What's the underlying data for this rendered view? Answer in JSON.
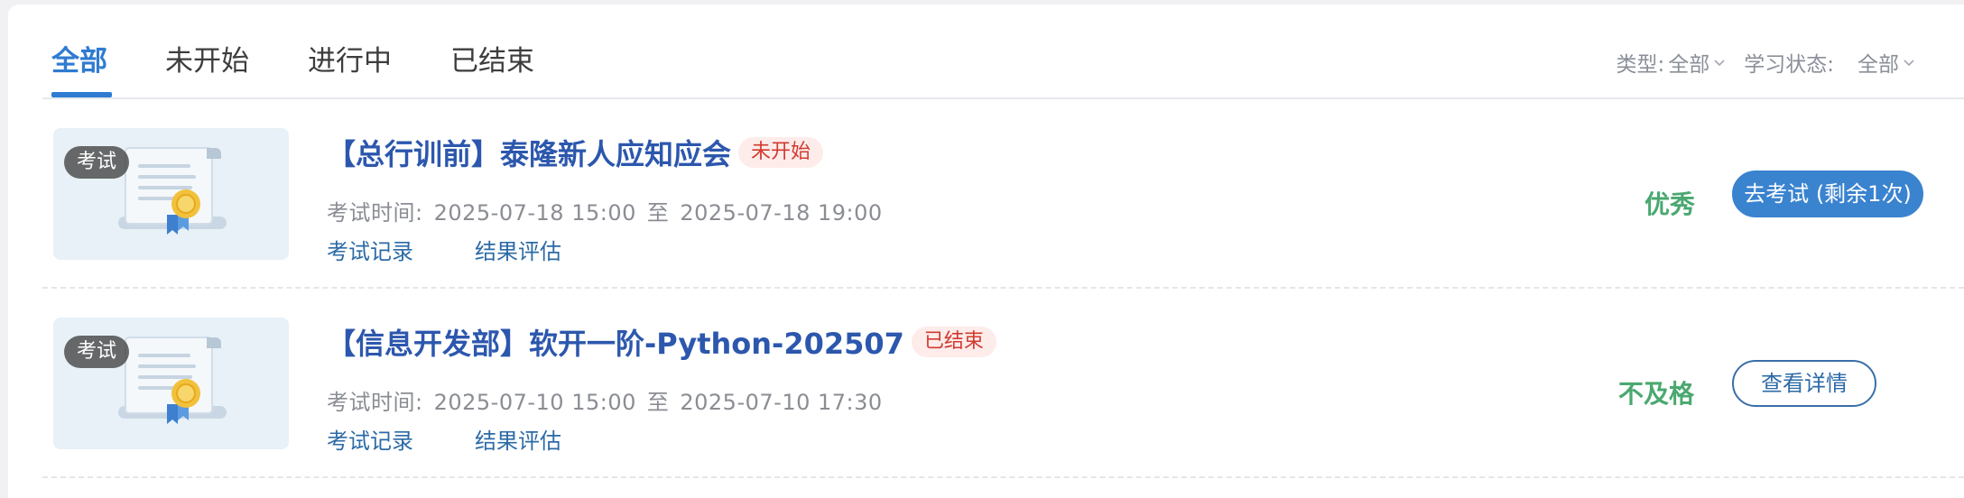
{
  "tabs": [
    {
      "label": "全部",
      "active": true
    },
    {
      "label": "未开始",
      "active": false
    },
    {
      "label": "进行中",
      "active": false
    },
    {
      "label": "已结束",
      "active": false
    }
  ],
  "filters": {
    "type": {
      "label": "类型:",
      "value": "全部"
    },
    "status": {
      "label": "学习状态:",
      "value": "全部"
    }
  },
  "colors": {
    "accent": "#2f7bd1",
    "title": "#2c57ad",
    "grade_green": "#4aa870",
    "tag_red": "#d23a30"
  },
  "items": [
    {
      "thumb_badge": "考试",
      "thumb_icon": "certificate-icon",
      "title": "【总行训前】泰隆新人应知应会",
      "status": "未开始",
      "time_label": "考试时间:",
      "time_start": "2025-07-18 15:00",
      "time_sep": "至",
      "time_end": "2025-07-18 19:00",
      "link_records": "考试记录",
      "link_evaluation": "结果评估",
      "grade": "优秀",
      "action": "去考试 (剩余1次)"
    },
    {
      "thumb_badge": "考试",
      "thumb_icon": "certificate-icon",
      "title": "【信息开发部】软开一阶-Python-202507",
      "status": "已结束",
      "time_label": "考试时间:",
      "time_start": "2025-07-10 15:00",
      "time_sep": "至",
      "time_end": "2025-07-10 17:30",
      "link_records": "考试记录",
      "link_evaluation": "结果评估",
      "grade": "不及格",
      "action": "查看详情"
    }
  ]
}
